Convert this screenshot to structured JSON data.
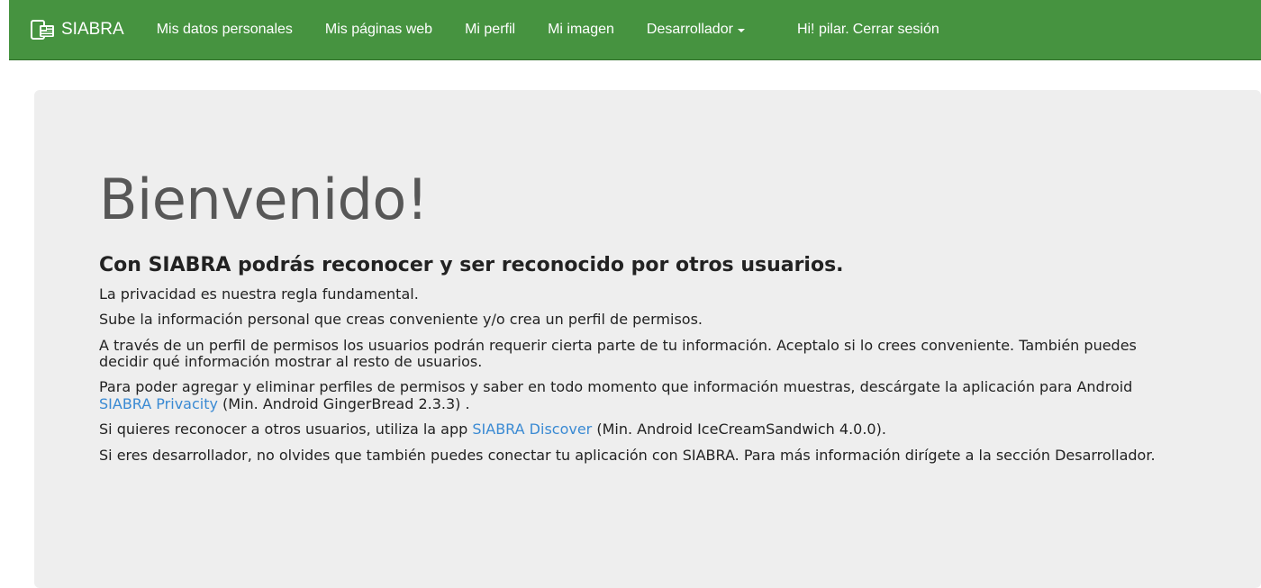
{
  "navbar": {
    "brand": "SIABRA",
    "items": [
      {
        "label": "Mis datos personales"
      },
      {
        "label": "Mis páginas web"
      },
      {
        "label": "Mi perfil"
      },
      {
        "label": "Mi imagen"
      },
      {
        "label": "Desarrollador"
      }
    ],
    "greeting": "Hi! pilar.",
    "logout": "Cerrar sesión",
    "background_color": "#469340"
  },
  "main": {
    "title": "Bienvenido!",
    "subtitle": "Con SIABRA podrás reconocer y ser reconocido por otros usuarios.",
    "p1": "La privacidad es nuestra regla fundamental.",
    "p2": "Sube la información personal que creas conveniente y/o crea un perfil de permisos.",
    "p3": "A través de un perfil de permisos los usuarios podrán requerir cierta parte de tu información. Aceptalo si lo crees conveniente. También puedes decidir qué información mostrar al resto de usuarios.",
    "p4": {
      "before": "Para poder agregar y eliminar perfiles de permisos y saber en todo momento que información muestras, descárgate la aplicación para Android ",
      "link": "SIABRA Privacity",
      "after": " (Min. Android GingerBread 2.3.3) ."
    },
    "p5": {
      "before": "Si quieres reconocer a otros usuarios, utiliza la app ",
      "link": "SIABRA Discover",
      "after": " (Min. Android IceCreamSandwich 4.0.0)."
    },
    "p6": "Si eres desarrollador, no olvides que también puedes conectar tu aplicación con SIABRA. Para más información dirígete a la sección Desarrollador.",
    "link_color": "#3a8ad3",
    "background_color": "#eeeeee"
  }
}
